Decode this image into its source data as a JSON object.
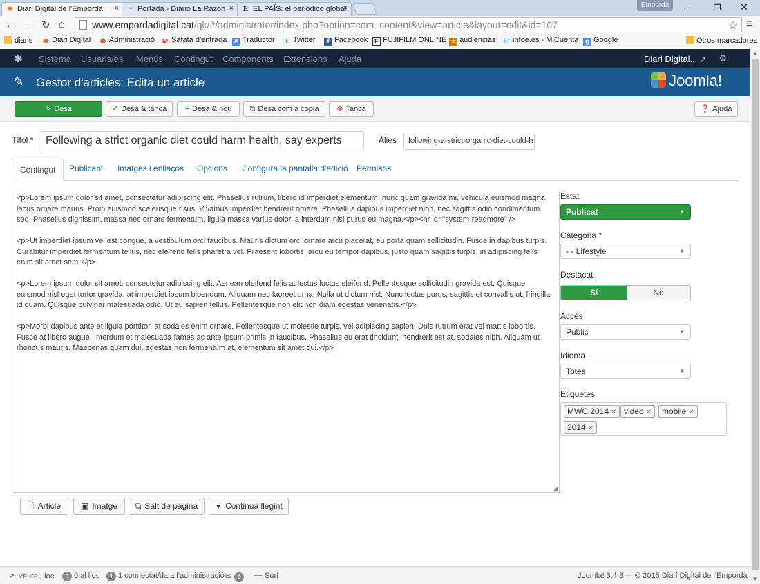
{
  "browser": {
    "tabs": [
      {
        "title": "Diari Digital de l'Empordà",
        "icon": "joomla-icon"
      },
      {
        "title": "Portada - Diario La Razón",
        "icon": "larazon-icon"
      },
      {
        "title": "EL PAÍS: el periódico global",
        "icon": "elpais-icon"
      }
    ],
    "profile": "Empordà",
    "url_domain": "www.empordadigital.cat",
    "url_path": "/gk/2/administrator/index.php?option=com_content&view=article&layout=edit&id=107",
    "bookmarks": [
      "diaris",
      "Diari Digital",
      "Administració",
      "Safata d'entrada",
      "Traductor",
      "Twitter",
      "Facebook",
      "FUJIFILM ONLINE",
      "audiencias",
      "infoe.es - MiCuenta",
      "Google"
    ],
    "other_bookmarks": "Otros marcadores"
  },
  "admin": {
    "menu": [
      "Sistema",
      "Usuaris/es",
      "Menús",
      "Contingut",
      "Components",
      "Extensions",
      "Ajuda"
    ],
    "site_link": "Diari Digital...",
    "page_title": "Gestor d'articles: Edita un article",
    "brand": "Joomla!"
  },
  "toolbar": {
    "save": "Desa",
    "save_close": "Desa & tanca",
    "save_new": "Desa & nou",
    "save_copy": "Desa com a còpia",
    "close": "Tanca",
    "help": "Ajuda"
  },
  "form": {
    "title_label": "Títol *",
    "title_value": "Following a strict organic diet could harm health, say experts",
    "alias_label": "Àlies",
    "alias_value": "following-a-strict-organic-diet-could-h",
    "tabs": [
      "Contingut",
      "Publicant",
      "Imatges i enllaços",
      "Opcions",
      "Configura la pantalla d'edició",
      "Permisos"
    ],
    "editor_paragraphs": [
      "<p>Lorem ipsum dolor sit amet, consectetur adipiscing elit. Phasellus rutrum, libero id imperdiet elementum, nunc quam gravida mi, vehicula euismod magna lacus ornare mauris. Proin euismod scelerisque risus. Vivamus imperdiet hendrerit ornare. Phasellus dapibus imperdiet nibh, nec sagittis odio condimentum sed. Phasellus dignissim, massa nec ornare fermentum, ligula massa varius dolor, a interdum nisl purus eu magna.</p><hr id=\"system-readmore\" />",
      "<p>Ut imperdiet ipsum vel est congue, a vestibulum orci faucibus. Mauris dictum orci ornare arcu placerat, eu porta quam sollicitudin. Fusce in dapibus turpis. Curabitur imperdiet fermentum tellus, nec eleifend felis pharetra vel. Praesent lobortis, arcu eu tempor dapibus, justo quam sagittis turpis, in adipiscing felis enim sit amet sem.</p>",
      "<p>Lorem ipsum dolor sit amet, consectetur adipiscing elit. Aenean eleifend felis at lectus luctus eleifend. Pellentesque sollicitudin gravida est. Quisque euismod nisl eget tortor gravida, at imperdiet ipsum bibendum. Aliquam nec laoreet urna. Nulla ut dictum nisl. Nunc lectus purus, sagittis et convallis ut, fringilla id quam. Quisque pulvinar malesuada odio. Ut eu sapien tellus. Pellentesque non elit non diam egestas venenatis.</p>",
      "<p>Morbi dapibus ante et ligula porttitor, at sodales enim ornare. Pellentesque ut molestie turpis, vel adipiscing sapien. Duis rutrum erat vel mattis lobortis. Fusce at libero augue. Interdum et malesuada fames ac ante ipsum primis in faucibus. Phasellus eu erat tincidunt, hendrerit est at, sodales nibh. Aliquam ut rhoncus mauris. Maecenas quam dui, egestas non fermentum at, elementum sit amet dui.</p>"
    ],
    "editor_buttons": [
      "Article",
      "Imatge",
      "Salt de pàgina",
      "Continua llegint"
    ]
  },
  "sidebar": {
    "status_label": "Estat",
    "status_value": "Publicat",
    "category_label": "Categoria *",
    "category_value": "- - Lifestyle",
    "featured_label": "Destacat",
    "featured_yes": "Sí",
    "featured_no": "No",
    "access_label": "Accés",
    "access_value": "Public",
    "language_label": "Idioma",
    "language_value": "Totes",
    "tags_label": "Etiquetes",
    "tags": [
      "MWC 2014",
      "video",
      "mobile",
      "2014"
    ]
  },
  "statusbar": {
    "view_site": "Veure Lloc",
    "visitors_count": "0",
    "visitors_text": "0 al lloc",
    "admins_count": "1",
    "admins_text": "1 connectat/da a l'administració",
    "messages_count": "0",
    "logout": "Surt",
    "version": "Joomla! 3.4.3 — © 2015 Diari Digital de l'Empordà"
  },
  "colors": {
    "nav_bg": "#17253c",
    "header_bg": "#1b5a8e",
    "green": "#2e9a40",
    "link": "#1b6bb0"
  }
}
